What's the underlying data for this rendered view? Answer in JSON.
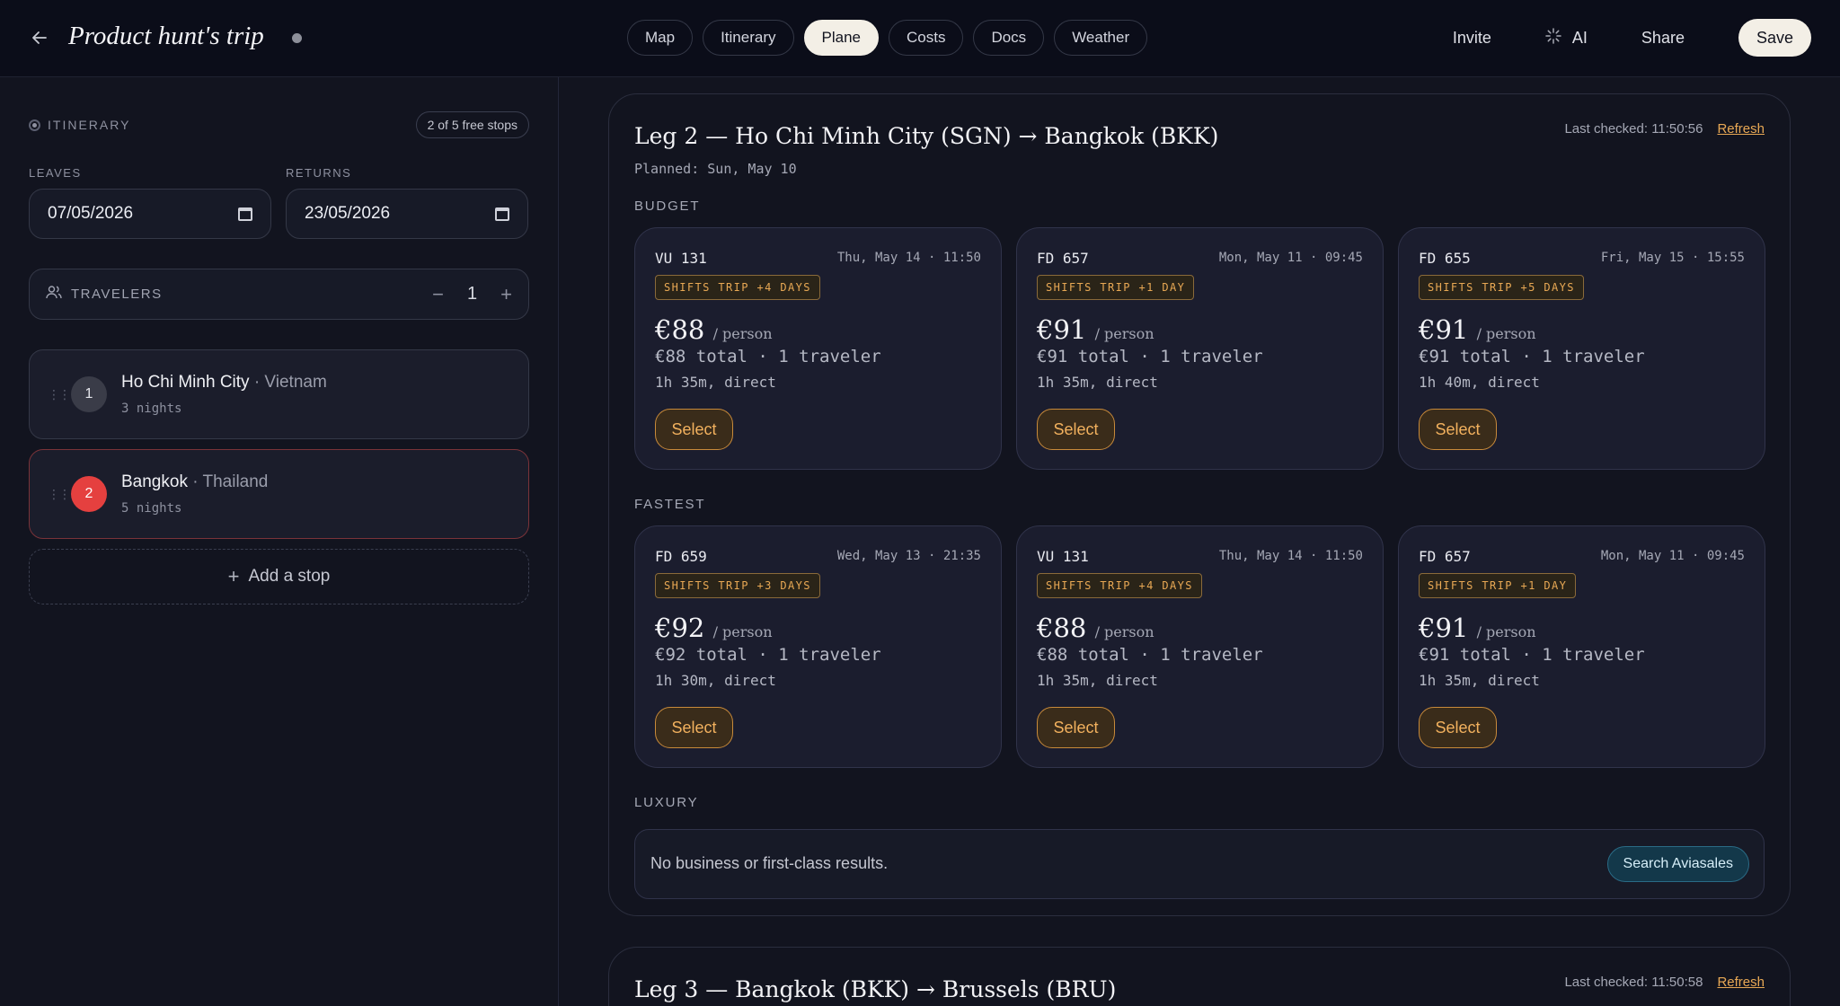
{
  "header": {
    "title": "Product hunt's trip",
    "tabs": [
      "Map",
      "Itinerary",
      "Plane",
      "Costs",
      "Docs",
      "Weather"
    ],
    "active_tab": "Plane",
    "invite": "Invite",
    "ai": "AI",
    "share": "Share",
    "save": "Save"
  },
  "sidebar": {
    "section_title": "ITINERARY",
    "free_stops": "2 of 5 free stops",
    "leaves_label": "LEAVES",
    "leaves_value": "07/05/2026",
    "returns_label": "RETURNS",
    "returns_value": "23/05/2026",
    "travelers_label": "TRAVELERS",
    "travelers_count": "1",
    "minus": "−",
    "plus": "+",
    "stops": [
      {
        "number": "1",
        "city": "Ho Chi Minh City",
        "country": " · Vietnam",
        "nights": "3 nights"
      },
      {
        "number": "2",
        "city": "Bangkok",
        "country": " · Thailand",
        "nights": "5 nights"
      }
    ],
    "add_stop": "Add a stop"
  },
  "leg2": {
    "title": "Leg 2 — Ho Chi Minh City (SGN) → Bangkok (BKK)",
    "planned": "Planned: Sun, May 10",
    "last_checked": "Last checked: 11:50:56",
    "refresh": "Refresh",
    "budget_label": "BUDGET",
    "fastest_label": "FASTEST",
    "luxury_label": "LUXURY",
    "budget": [
      {
        "flight": "VU 131",
        "when": "Thu, May 14 · 11:50",
        "badge": "SHIFTS TRIP +4 DAYS",
        "price": "€88",
        "per": "/ person",
        "total": "€88 total · 1 traveler",
        "duration": "1h 35m, direct",
        "select": "Select"
      },
      {
        "flight": "FD 657",
        "when": "Mon, May 11 · 09:45",
        "badge": "SHIFTS TRIP +1 DAY",
        "price": "€91",
        "per": "/ person",
        "total": "€91 total · 1 traveler",
        "duration": "1h 35m, direct",
        "select": "Select"
      },
      {
        "flight": "FD 655",
        "when": "Fri, May 15 · 15:55",
        "badge": "SHIFTS TRIP +5 DAYS",
        "price": "€91",
        "per": "/ person",
        "total": "€91 total · 1 traveler",
        "duration": "1h 40m, direct",
        "select": "Select"
      }
    ],
    "fastest": [
      {
        "flight": "FD 659",
        "when": "Wed, May 13 · 21:35",
        "badge": "SHIFTS TRIP +3 DAYS",
        "price": "€92",
        "per": "/ person",
        "total": "€92 total · 1 traveler",
        "duration": "1h 30m, direct",
        "select": "Select"
      },
      {
        "flight": "VU 131",
        "when": "Thu, May 14 · 11:50",
        "badge": "SHIFTS TRIP +4 DAYS",
        "price": "€88",
        "per": "/ person",
        "total": "€88 total · 1 traveler",
        "duration": "1h 35m, direct",
        "select": "Select"
      },
      {
        "flight": "FD 657",
        "when": "Mon, May 11 · 09:45",
        "badge": "SHIFTS TRIP +1 DAY",
        "price": "€91",
        "per": "/ person",
        "total": "€91 total · 1 traveler",
        "duration": "1h 35m, direct",
        "select": "Select"
      }
    ],
    "luxury_text": "No business or first-class results.",
    "search_aviasales": "Search Aviasales"
  },
  "leg3": {
    "title": "Leg 3 — Bangkok (BKK) → Brussels (BRU)",
    "last_checked": "Last checked: 11:50:58",
    "refresh": "Refresh"
  },
  "icons": {
    "back": "arrow-left-icon",
    "ai": "sparkle-icon",
    "travelers": "users-icon",
    "calendar": "calendar-icon",
    "grip": "drag-handle-icon"
  },
  "colors": {
    "accent": "#e8a854",
    "active_stop": "#e5403f",
    "background": "#12141f"
  }
}
